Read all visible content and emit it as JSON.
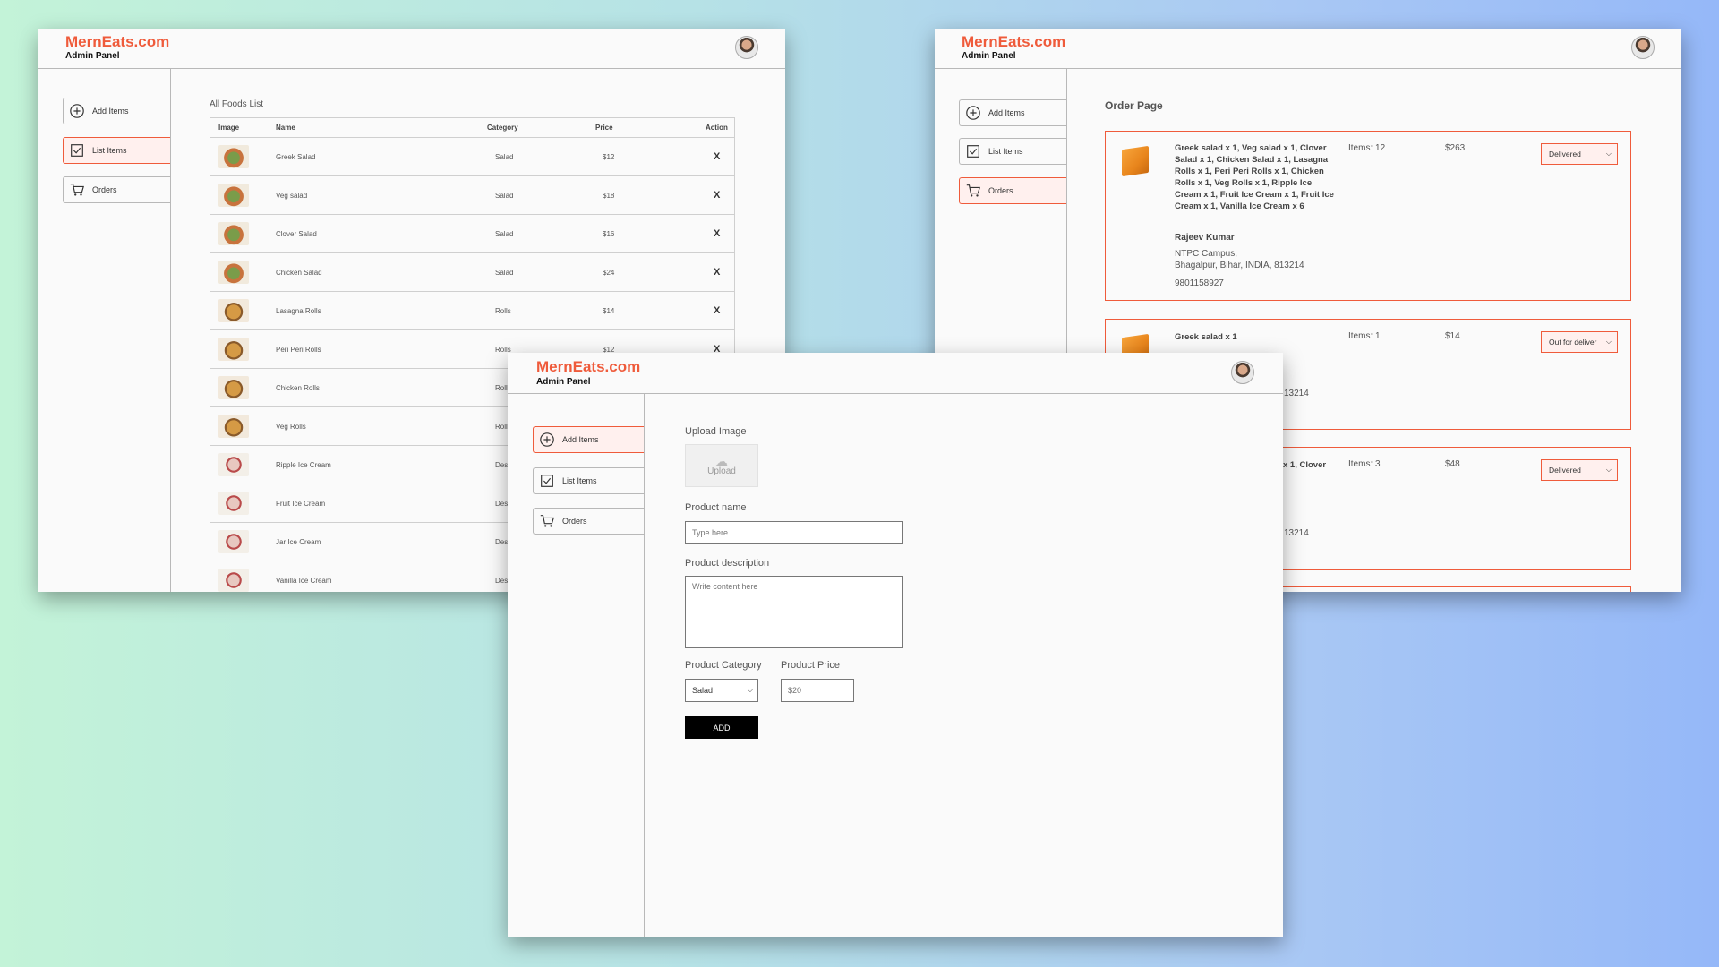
{
  "brand": {
    "logo": "MernEats.com",
    "subtitle": "Admin Panel"
  },
  "sidebar": {
    "add": "Add Items",
    "list": "List Items",
    "orders": "Orders"
  },
  "list_page": {
    "title": "All Foods List",
    "headers": {
      "image": "Image",
      "name": "Name",
      "category": "Category",
      "price": "Price",
      "action": "Action"
    },
    "rows": [
      {
        "name": "Greek Salad",
        "category": "Salad",
        "price": "$12",
        "action": "X"
      },
      {
        "name": "Veg salad",
        "category": "Salad",
        "price": "$18",
        "action": "X"
      },
      {
        "name": "Clover Salad",
        "category": "Salad",
        "price": "$16",
        "action": "X"
      },
      {
        "name": "Chicken Salad",
        "category": "Salad",
        "price": "$24",
        "action": "X"
      },
      {
        "name": "Lasagna Rolls",
        "category": "Rolls",
        "price": "$14",
        "action": "X"
      },
      {
        "name": "Peri Peri Rolls",
        "category": "Rolls",
        "price": "$12",
        "action": "X"
      },
      {
        "name": "Chicken Rolls",
        "category": "Rolls",
        "price": "",
        "action": ""
      },
      {
        "name": "Veg Rolls",
        "category": "Rolls",
        "price": "",
        "action": ""
      },
      {
        "name": "Ripple Ice Cream",
        "category": "Desert",
        "price": "",
        "action": ""
      },
      {
        "name": "Fruit Ice Cream",
        "category": "Desert",
        "price": "",
        "action": ""
      },
      {
        "name": "Jar Ice Cream",
        "category": "Desert",
        "price": "",
        "action": ""
      },
      {
        "name": "Vanilla Ice Cream",
        "category": "Desert",
        "price": "",
        "action": ""
      }
    ]
  },
  "order_page": {
    "title": "Order Page",
    "orders": [
      {
        "items": "Greek salad x 1, Veg salad x 1, Clover Salad x 1, Chicken Salad x 1, Lasagna Rolls x 1, Peri Peri Rolls x 1, Chicken Rolls x 1, Veg Rolls x 1, Ripple Ice Cream x 1, Fruit Ice Cream x 1, Fruit Ice Cream x 1, Vanilla Ice Cream x 6",
        "customer": "Rajeev Kumar",
        "address1": "NTPC Campus,",
        "address2": "Bhagalpur, Bihar, INDIA, 813214",
        "phone": "9801158927",
        "count": "Items: 12",
        "amount": "$263",
        "status": "Delivered"
      },
      {
        "items": "Greek salad x 1",
        "address_tail": "13214",
        "count": "Items: 1",
        "amount": "$14",
        "status": "Out for deliver"
      },
      {
        "items": "x 1, Clover",
        "address_tail": "13214",
        "count": "Items: 3",
        "amount": "$48",
        "status": "Delivered"
      }
    ]
  },
  "add_page": {
    "upload_label": "Upload Image",
    "upload_text": "Upload",
    "name_label": "Product name",
    "name_placeholder": "Type here",
    "desc_label": "Product description",
    "desc_placeholder": "Write content here",
    "category_label": "Product Category",
    "category_value": "Salad",
    "price_label": "Product Price",
    "price_placeholder": "$20",
    "add_button": "ADD"
  }
}
